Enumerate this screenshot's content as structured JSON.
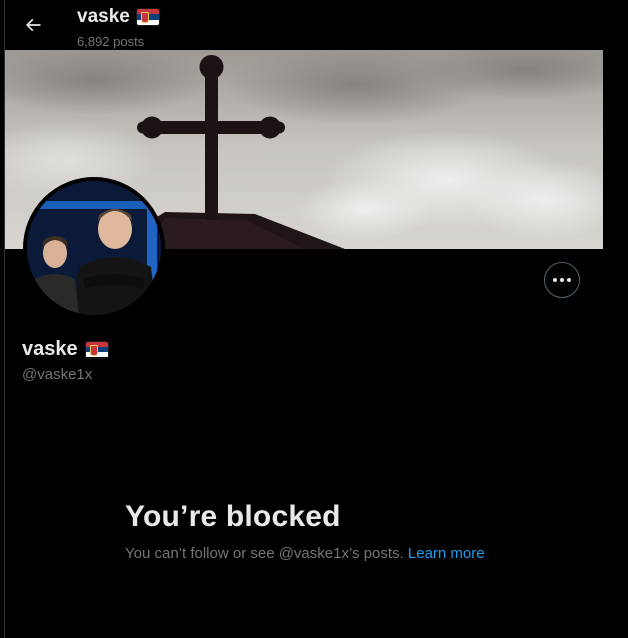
{
  "header": {
    "name": "vaske",
    "posts_count": "6,892 posts"
  },
  "profile": {
    "display_name": "vaske",
    "handle": "@vaske1x",
    "flag": "serbia-flag"
  },
  "blocked": {
    "title": "You’re blocked",
    "description": "You can’t follow or see @vaske1x’s posts.",
    "learn_more": "Learn more"
  },
  "icons": {
    "back": "arrow-left-icon",
    "more": "more-horizontal-icon"
  },
  "colors": {
    "background": "#000000",
    "text_primary": "#e7e9ea",
    "text_secondary": "#71767b",
    "link": "#1d9bf0",
    "border": "#2f3336"
  }
}
